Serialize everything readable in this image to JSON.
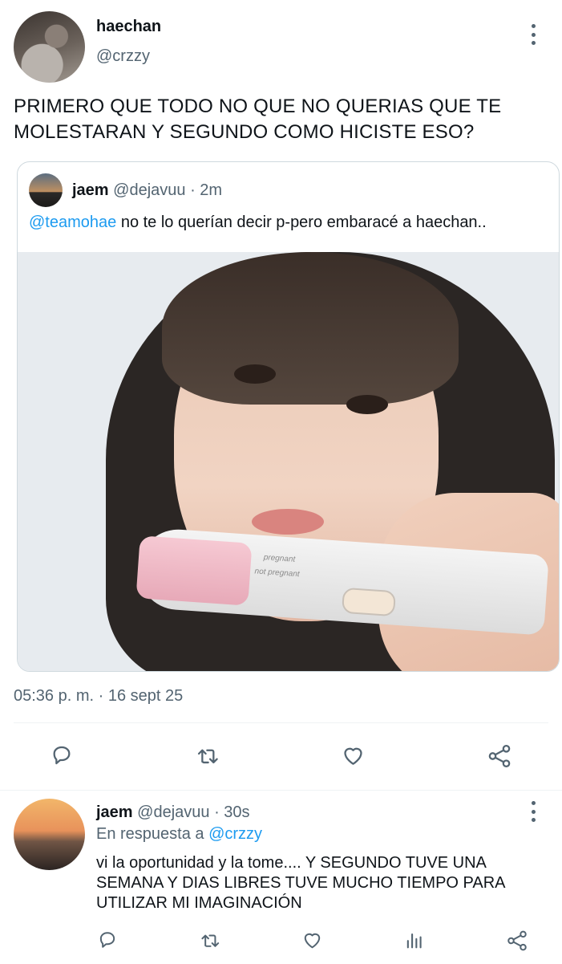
{
  "tweet": {
    "author_name": "haechan",
    "author_handle": "@crzzy",
    "text": "PRIMERO QUE TODO NO QUE NO QUERIAS QUE TE MOLESTARAN Y SEGUNDO COMO HICISTE ESO?",
    "timestamp": "05:36 p. m. · 16 sept 25",
    "icons": [
      "reply-icon",
      "retweet-icon",
      "like-icon",
      "share-icon"
    ]
  },
  "quote": {
    "author_name": "jaem",
    "author_handle": "@dejavuu",
    "time": "· 2m",
    "mention": "@teamohae",
    "text": " no te lo querían decir p-pero embaracé a haechan..",
    "photo_text": [
      "pregnant",
      "not pregnant"
    ]
  },
  "reply": {
    "author_name": "jaem",
    "author_handle": "@dejavuu",
    "time": "· 30s",
    "replying_prefix": "En respuesta a ",
    "replying_handle": "@crzzy",
    "text": "vi la oportunidad y la tome.... Y SEGUNDO TUVE UNA SEMANA Y DIAS LIBRES TUVE MUCHO TIEMPO PARA UTILIZAR MI IMAGINACIÓN",
    "icons": [
      "reply-icon",
      "retweet-icon",
      "like-icon",
      "stats-icon",
      "share-icon"
    ]
  },
  "colors": {
    "text": "#0f1419",
    "secondary": "#536471",
    "link": "#1d9bf0",
    "border": "#cfd9de"
  }
}
